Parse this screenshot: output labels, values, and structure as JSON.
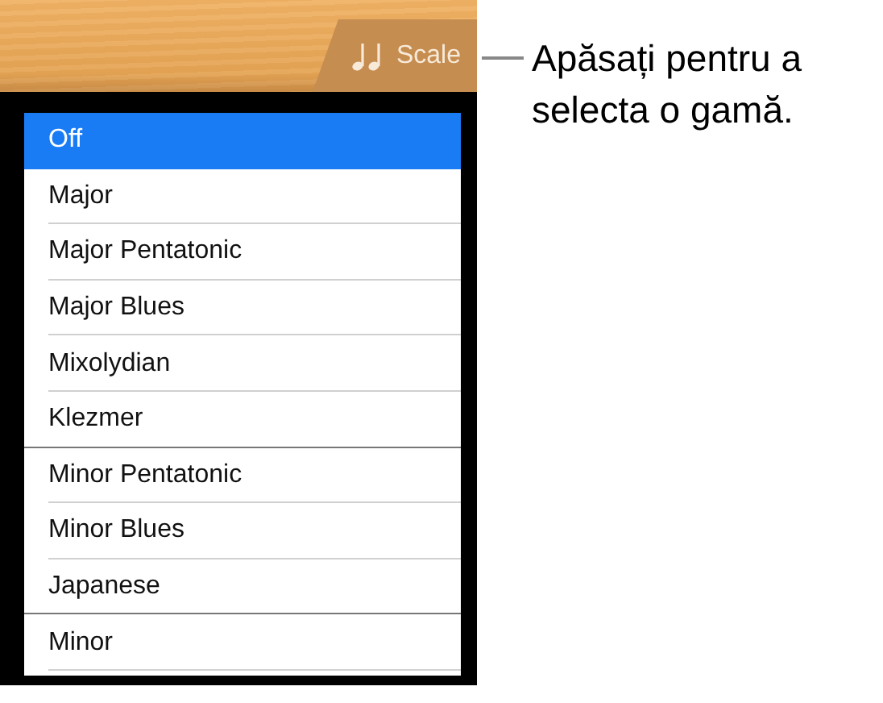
{
  "toolbar": {
    "scale_button": {
      "label": "Scale"
    }
  },
  "callout": "Apăsați pentru a selecta o gamă.",
  "scales": [
    {
      "label": "Off",
      "selected": true,
      "section_break": false
    },
    {
      "label": "Major",
      "selected": false,
      "section_break": false
    },
    {
      "label": "Major Pentatonic",
      "selected": false,
      "section_break": false
    },
    {
      "label": "Major Blues",
      "selected": false,
      "section_break": false
    },
    {
      "label": "Mixolydian",
      "selected": false,
      "section_break": false
    },
    {
      "label": "Klezmer",
      "selected": false,
      "section_break": true
    },
    {
      "label": "Minor Pentatonic",
      "selected": false,
      "section_break": false
    },
    {
      "label": "Minor Blues",
      "selected": false,
      "section_break": false
    },
    {
      "label": "Japanese",
      "selected": false,
      "section_break": true
    },
    {
      "label": "Minor",
      "selected": false,
      "section_break": false
    }
  ]
}
